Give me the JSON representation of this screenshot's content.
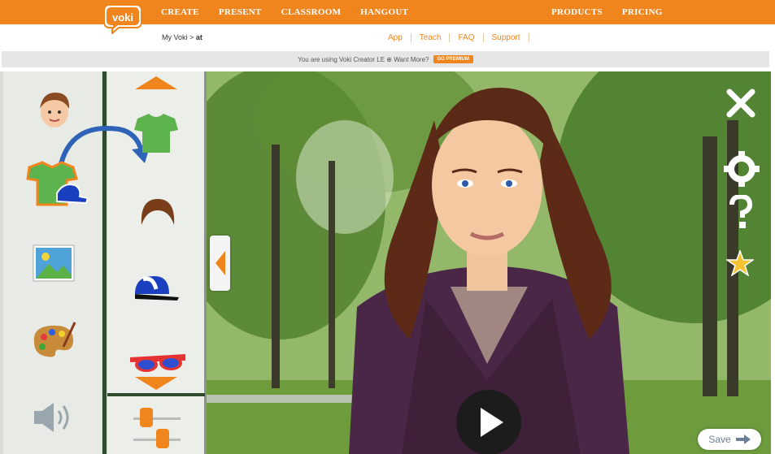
{
  "brand": {
    "logo_text": "voki",
    "accent": "#f0851e"
  },
  "nav": {
    "left": [
      "CREATE",
      "PRESENT",
      "CLASSROOM",
      "HANGOUT"
    ],
    "right": [
      "PRODUCTS",
      "PRICING"
    ]
  },
  "breadcrumb": {
    "root": "My Voki",
    "separator": ">",
    "current": "at"
  },
  "sublinks": [
    "App",
    "Teach",
    "FAQ",
    "Support"
  ],
  "premium": {
    "message": "You are using Voki Creator LE",
    "info_icon": "⊕",
    "want_more": "Want More?",
    "button": "GO PREMIUM"
  },
  "left_tools": [
    "face-icon",
    "clothing-and-accessories-icon",
    "background-image-icon",
    "color-palette-icon",
    "speaker-icon"
  ],
  "right_tools": [
    "up-arrow-icon",
    "shirt-icon",
    "hair-icon",
    "cap-icon",
    "glasses-icon",
    "down-arrow-icon",
    "sliders-icon"
  ],
  "right_controls": [
    "close-icon",
    "settings-gear-icon",
    "help-question-icon",
    "favorite-star-icon"
  ],
  "save": {
    "label": "Save"
  }
}
